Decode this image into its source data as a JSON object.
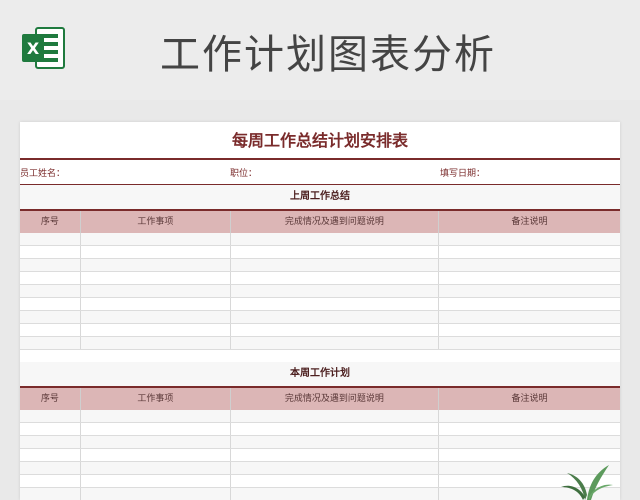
{
  "header": {
    "title": "工作计划图表分析"
  },
  "sheet": {
    "title": "每周工作总结计划安排表",
    "fields": {
      "name": "员工姓名：",
      "position": "职位：",
      "date": "填写日期："
    },
    "section1": {
      "title": "上周工作总结"
    },
    "section2": {
      "title": "本周工作计划"
    },
    "columns": [
      "序号",
      "工作事项",
      "完成情况及遇到问题说明",
      "备注说明"
    ]
  },
  "colors": {
    "accent": "#7a2b2b",
    "header_bg": "#dcb6b6",
    "excel_green": "#1f7a3e"
  }
}
